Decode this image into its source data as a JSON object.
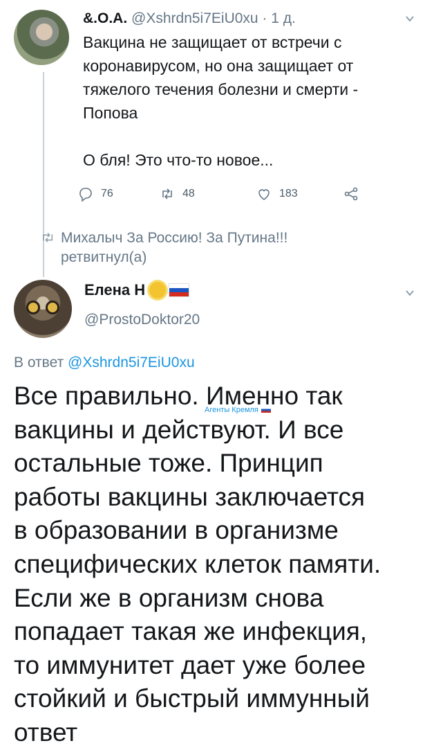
{
  "tweet1": {
    "author_name": "&.O.A.",
    "handle": "@Xshrdn5i7EiU0xu",
    "separator": " · ",
    "time": "1 д.",
    "lines": [
      "Вакцина не защищает от встречи с",
      "коронавирусом, но она защищает от",
      "тяжелого течения болезни и смерти -",
      "Попова"
    ],
    "comment": "О бля! Это что-то новое...",
    "replies": "76",
    "retweets": "48",
    "likes": "183"
  },
  "retweet_note": {
    "line1": "Михалыч За Россию! За Путина!!!",
    "line2": "ретвитнул(а)"
  },
  "tweet2": {
    "author_name": "Елена Н",
    "handle": "@ProstoDoktor20",
    "reply_prefix": "В ответ ",
    "reply_to": "@Xshrdn5i7EiU0xu",
    "lines": [
      "Все правильно. Именно так",
      "вакцины и действуют. И все",
      "остальные тоже. Принцип",
      "работы вакцины заключается",
      "в образовании в организме",
      "специфических клеток памяти.",
      "Если же в организм снова",
      "попадает такая же инфекция,",
      "то иммунитет дает уже более",
      "стойкий и быстрый иммунный",
      "ответ"
    ]
  },
  "watermark": "Агенты Кремля",
  "colors": {
    "link": "#1b95e0",
    "muted": "#657786",
    "text": "#14171a"
  }
}
